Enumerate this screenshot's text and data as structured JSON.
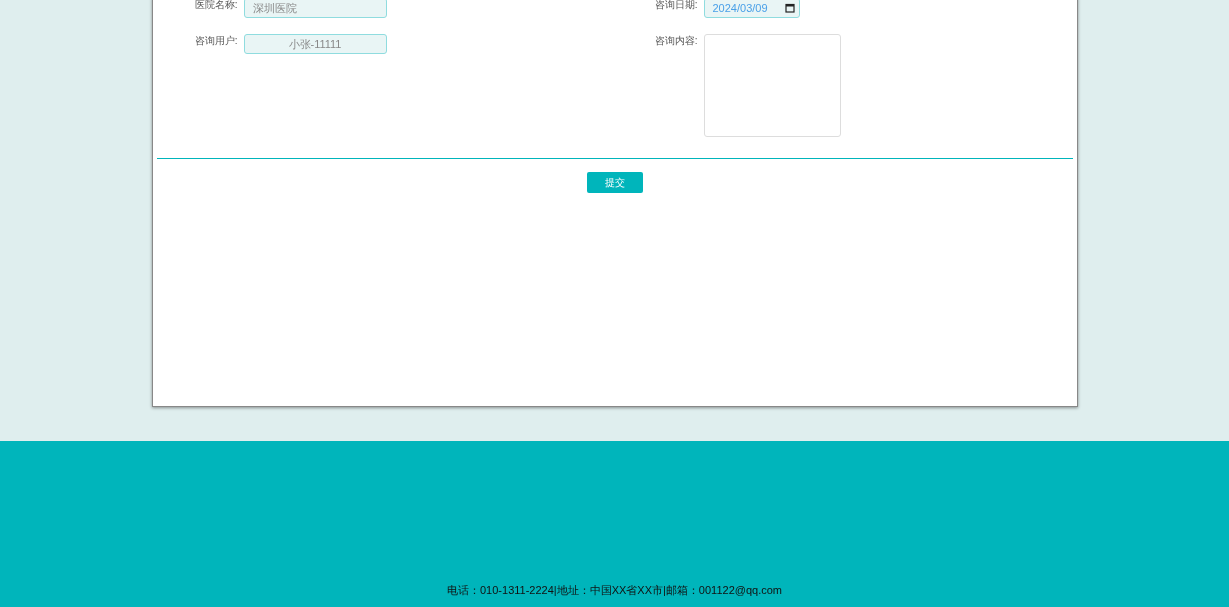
{
  "form": {
    "fields": [
      {
        "kind": "text",
        "label": "医院名称:",
        "value": "深圳医院"
      },
      {
        "kind": "date",
        "label": "咨询日期:",
        "value": "2024/03/09"
      },
      {
        "kind": "centered",
        "label": "咨询用户:",
        "value": "小张-11111"
      },
      {
        "kind": "textarea",
        "label": "咨询内容:"
      }
    ],
    "submit": "提交"
  },
  "footer": {
    "text": "电话：010-1311-2224|地址：中国XX省XX市|邮箱：001122@qq.com"
  }
}
